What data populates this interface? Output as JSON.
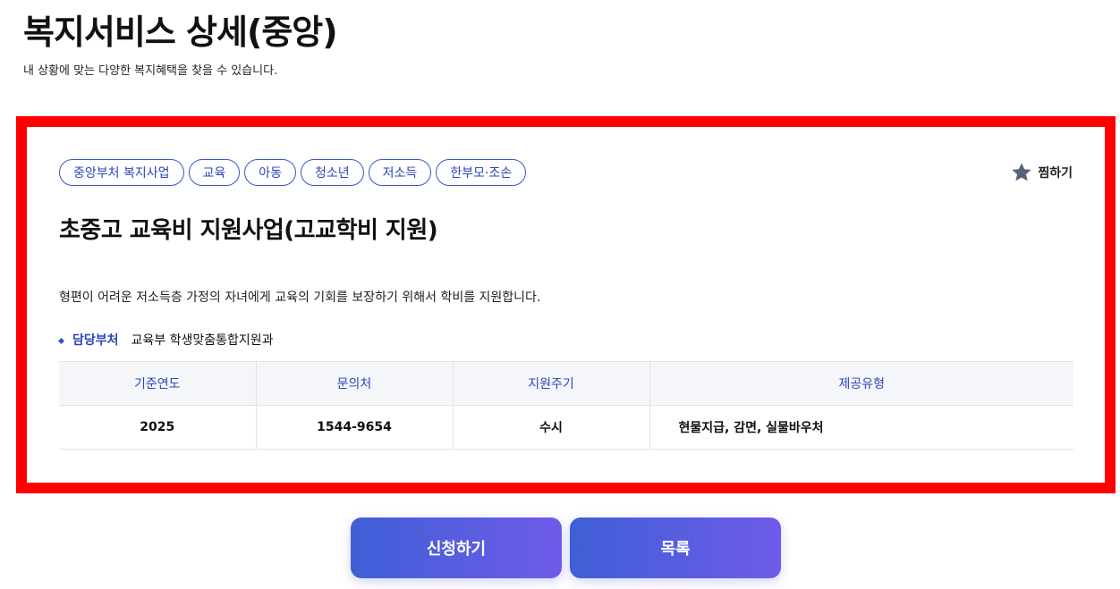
{
  "header": {
    "title": "복지서비스 상세(중앙)",
    "subtitle": "내 상황에 맞는 다양한 복지혜택을 찾을 수 있습니다."
  },
  "service": {
    "tags": [
      "중앙부처 복지사업",
      "교육",
      "아동",
      "청소년",
      "저소득",
      "한부모·조손"
    ],
    "bookmark_label": "찜하기",
    "title": "초중고 교육비 지원사업(고교학비 지원)",
    "description": "형편이 어려운 저소득층 가정의 자녀에게 교육의 기회를 보장하기 위해서 학비를 지원합니다.",
    "department": {
      "label": "담당부처",
      "value": "교육부 학생맞춤통합지원과"
    },
    "table": {
      "headers": [
        "기준연도",
        "문의처",
        "지원주기",
        "제공유형"
      ],
      "row": [
        "2025",
        "1544-9654",
        "수시",
        "현물지급, 감면, 실물바우처"
      ]
    }
  },
  "actions": {
    "apply_label": "신청하기",
    "list_label": "목록"
  },
  "colors": {
    "accent": "#2c46b8",
    "frame": "#ff0000",
    "button_start": "#3f5fd6",
    "button_end": "#6f5be9"
  }
}
